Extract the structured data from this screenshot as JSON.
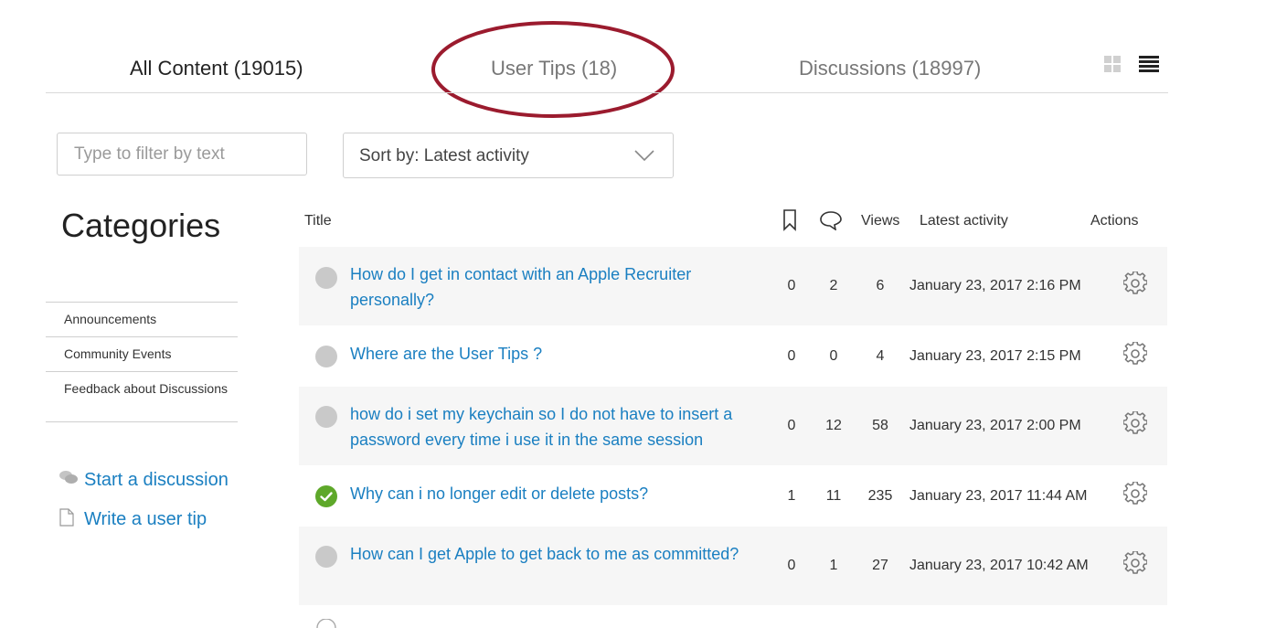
{
  "tabs": {
    "all_content": "All Content (19015)",
    "user_tips": "User Tips (18)",
    "discussions": "Discussions (18997)"
  },
  "highlight_color": "#9b1b2e",
  "link_color": "#1a7fc1",
  "filter": {
    "placeholder": "Type to filter by text",
    "value": ""
  },
  "sort": {
    "label": "Sort by: Latest activity"
  },
  "sidebar": {
    "title": "Categories",
    "categories": [
      "Announcements",
      "Community Events",
      "Feedback about Discussions"
    ],
    "actions": {
      "start_discussion": "Start a discussion",
      "write_user_tip": "Write a user tip"
    }
  },
  "table": {
    "headers": {
      "title": "Title",
      "bookmark_icon": "bookmark-icon",
      "replies_icon": "speech-bubble-icon",
      "views": "Views",
      "latest_activity": "Latest activity",
      "actions": "Actions"
    },
    "rows": [
      {
        "status": "unanswered",
        "title": "How do I get in contact with an Apple Recruiter personally?",
        "bookmarks": "0",
        "replies": "2",
        "views": "6",
        "latest_activity": "January 23, 2017 2:16 PM"
      },
      {
        "status": "unanswered",
        "title": "Where are the User Tips ?",
        "bookmarks": "0",
        "replies": "0",
        "views": "4",
        "latest_activity": "January 23, 2017 2:15 PM"
      },
      {
        "status": "unanswered",
        "title": "how do i set my keychain so I do not have to insert a password every time i use it in the same session",
        "bookmarks": "0",
        "replies": "12",
        "views": "58",
        "latest_activity": "January 23, 2017 2:00 PM"
      },
      {
        "status": "solved",
        "title": "Why can i no longer edit or delete posts?",
        "bookmarks": "1",
        "replies": "11",
        "views": "235",
        "latest_activity": "January 23, 2017 11:44 AM"
      },
      {
        "status": "unanswered",
        "title": "How can I get Apple to get back to me as committed?",
        "bookmarks": "0",
        "replies": "1",
        "views": "27",
        "latest_activity": "January 23, 2017 10:42 AM"
      }
    ]
  }
}
